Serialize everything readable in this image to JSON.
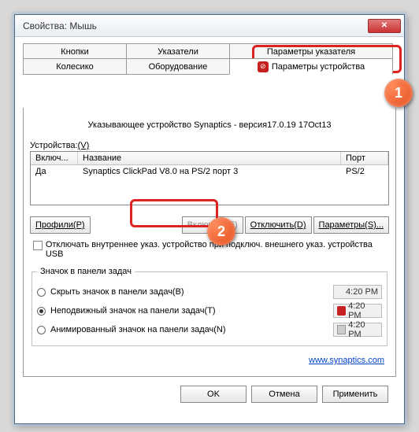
{
  "window": {
    "title": "Свойства: Мышь"
  },
  "tabs": {
    "top": [
      "Кнопки",
      "Указатели",
      "Параметры указателя"
    ],
    "bottom": [
      "Колесико",
      "Оборудование",
      "Параметры устройства"
    ]
  },
  "panel": {
    "header": "Указывающее устройство Synaptics - версия17.0.19 17Oct13",
    "devices_label": "Устройства:",
    "devices_key": "(V)",
    "columns": {
      "enabled": "Включ...",
      "name": "Название",
      "port": "Порт"
    },
    "row": {
      "enabled": "Да",
      "name": "Synaptics ClickPad V8.0 на PS/2 порт 3",
      "port": "PS/2"
    }
  },
  "buttons": {
    "profiles": "Профили(P)",
    "enable": "Включить(E)",
    "disable": "Отключить(D)",
    "params": "Параметры(S)..."
  },
  "checkbox_label": "Отключать внутреннее указ. устройство при подключ. внешнего указ. устройства USB",
  "tray": {
    "legend": "Значок в панели задач",
    "opt1": "Скрыть значок в панели задач(B)",
    "opt2": "Неподвижный значок на панели задач(T)",
    "opt3": "Анимированный значок на панели задач(N)",
    "time": "4:20 PM"
  },
  "link": "www.synaptics.com",
  "footer": {
    "ok": "OK",
    "cancel": "Отмена",
    "apply": "Применить"
  },
  "badges": {
    "one": "1",
    "two": "2"
  }
}
